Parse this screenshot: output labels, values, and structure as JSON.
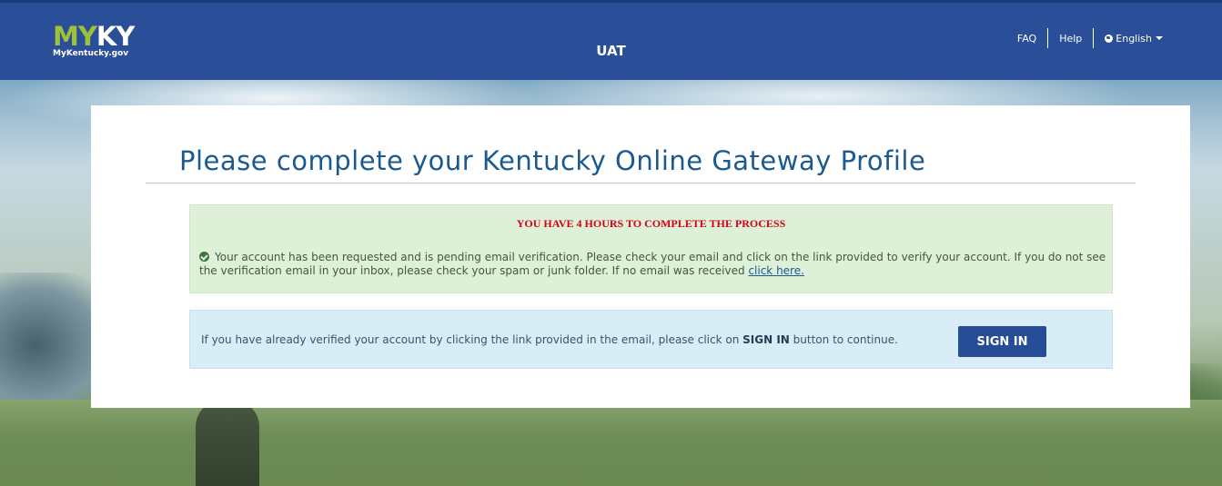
{
  "header": {
    "logo_my": "MY",
    "logo_ky": "KY",
    "logo_sub": "MyKentucky.gov",
    "environment": "UAT",
    "nav": {
      "faq": "FAQ",
      "help": "Help",
      "language": "English"
    }
  },
  "main": {
    "title": "Please complete your Kentucky Online Gateway Profile",
    "success_alert": {
      "countdown": "YOU HAVE 4 HOURS TO COMPLETE THE PROCESS",
      "message": "Your account has been requested and is pending email verification. Please check your email and click on the link provided to verify your account. If you do not see the verification email in your inbox, please check your spam or junk folder. If no email was received",
      "link": "click here."
    },
    "info_alert": {
      "text_before": "If you have already verified your account by clicking the link provided in the email, please click on",
      "text_bold": "SIGN IN",
      "text_after": "button to continue.",
      "button": "SIGN IN"
    }
  },
  "colors": {
    "header_bg": "#2b4e99",
    "title": "#1a5a91",
    "countdown": "#d0021b",
    "success_bg": "#dff0d8",
    "info_bg": "#d9edf7",
    "button_bg": "#274c97"
  },
  "icons": {
    "success": "check-circle-icon",
    "language": "globe-icon",
    "dropdown": "caret-down-icon"
  }
}
